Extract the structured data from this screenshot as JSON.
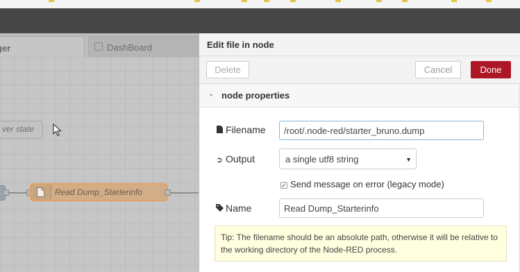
{
  "workspace": {
    "tabs": [
      {
        "label": "ger"
      },
      {
        "label": "DashBoard"
      }
    ],
    "nodes": {
      "partial_node_label": "ver state",
      "file_node_label": "Read Dump_Starterinfo"
    }
  },
  "editor": {
    "title": "Edit file in node",
    "buttons": {
      "delete": "Delete",
      "cancel": "Cancel",
      "done": "Done"
    },
    "section": {
      "label": "node properties"
    },
    "fields": {
      "filename": {
        "label": "Filename",
        "value": "/root/.node-red/starter_bruno.dump"
      },
      "output": {
        "label": "Output",
        "value": "a single utf8 string"
      },
      "send_error": {
        "label": "Send message on error (legacy mode)",
        "checked": true
      },
      "name": {
        "label": "Name",
        "value": "Read Dump_Starterinfo"
      }
    },
    "tip": "Tip: The filename should be an absolute path, otherwise it will be relative to the working directory of the Node-RED process."
  },
  "colors": {
    "header": "#464646",
    "done_button": "#ad1625",
    "file_node_border": "#e5a15f",
    "tip_background": "#ffffe0"
  }
}
